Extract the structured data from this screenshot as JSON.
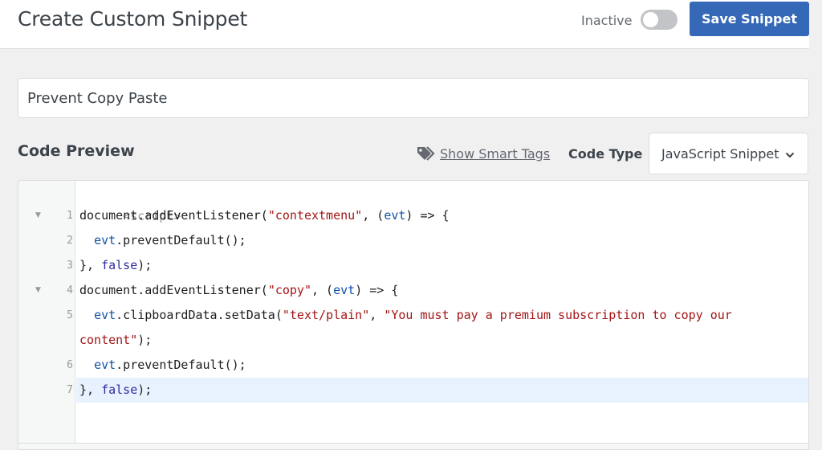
{
  "header": {
    "title": "Create Custom Snippet",
    "status_label": "Inactive",
    "toggle_active": false,
    "save_label": "Save Snippet",
    "accent_color": "#3568b7"
  },
  "snippet": {
    "title_value": "Prevent Copy Paste",
    "title_placeholder": ""
  },
  "code_preview": {
    "heading": "Code Preview",
    "smart_tags_label": "Show Smart Tags",
    "smart_tags_icon": "tag-icon",
    "code_type_label": "Code Type",
    "code_type_value": "JavaScript Snippet",
    "code_type_icon": "chevron-down-icon"
  },
  "editor": {
    "prefix": "<script>",
    "active_line": 7,
    "lines": [
      {
        "number": "1",
        "foldable": true,
        "tokens": [
          {
            "t": "document.addEventListener(",
            "c": ""
          },
          {
            "t": "\"contextmenu\"",
            "c": "str"
          },
          {
            "t": ", (",
            "c": ""
          },
          {
            "t": "evt",
            "c": "var"
          },
          {
            "t": ") => {",
            "c": ""
          }
        ]
      },
      {
        "number": "2",
        "foldable": false,
        "tokens": [
          {
            "t": "  ",
            "c": ""
          },
          {
            "t": "evt",
            "c": "var"
          },
          {
            "t": ".preventDefault();",
            "c": ""
          }
        ]
      },
      {
        "number": "3",
        "foldable": false,
        "tokens": [
          {
            "t": "}, ",
            "c": ""
          },
          {
            "t": "false",
            "c": "kw"
          },
          {
            "t": ");",
            "c": ""
          }
        ]
      },
      {
        "number": "4",
        "foldable": true,
        "tokens": [
          {
            "t": "document.addEventListener(",
            "c": ""
          },
          {
            "t": "\"copy\"",
            "c": "str"
          },
          {
            "t": ", (",
            "c": ""
          },
          {
            "t": "evt",
            "c": "var"
          },
          {
            "t": ") => {",
            "c": ""
          }
        ]
      },
      {
        "number": "5",
        "foldable": false,
        "tokens": [
          {
            "t": "  ",
            "c": ""
          },
          {
            "t": "evt",
            "c": "var"
          },
          {
            "t": ".clipboardData.setData(",
            "c": ""
          },
          {
            "t": "\"text/plain\"",
            "c": "str"
          },
          {
            "t": ", ",
            "c": ""
          },
          {
            "t": "\"You must pay a premium subscription to copy our",
            "c": "str"
          }
        ]
      },
      {
        "number": "",
        "foldable": false,
        "wrap": true,
        "tokens": [
          {
            "t": "content\"",
            "c": "str"
          },
          {
            "t": ");",
            "c": ""
          }
        ]
      },
      {
        "number": "6",
        "foldable": false,
        "tokens": [
          {
            "t": "  ",
            "c": ""
          },
          {
            "t": "evt",
            "c": "var"
          },
          {
            "t": ".preventDefault();",
            "c": ""
          }
        ]
      },
      {
        "number": "7",
        "foldable": false,
        "active": true,
        "tokens": [
          {
            "t": "}, ",
            "c": ""
          },
          {
            "t": "false",
            "c": "kw"
          },
          {
            "t": ");",
            "c": ""
          }
        ]
      }
    ]
  }
}
